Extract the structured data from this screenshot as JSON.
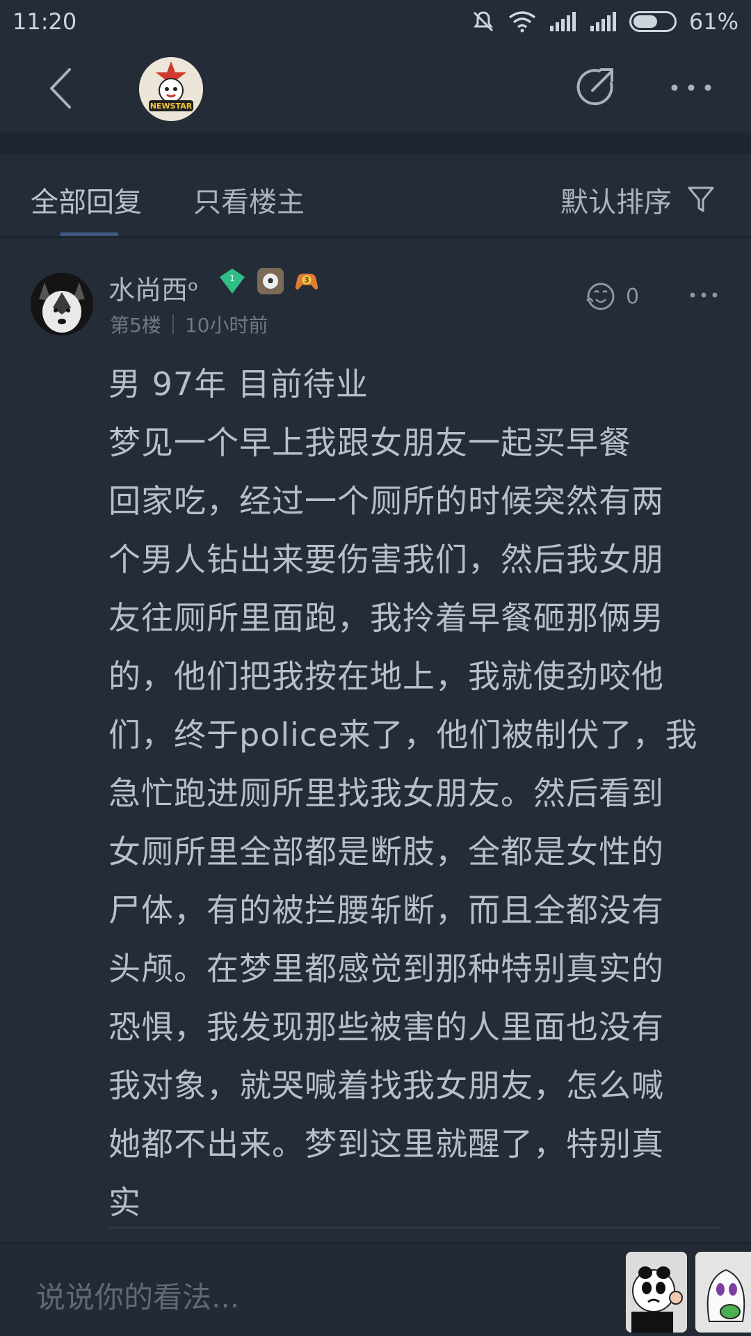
{
  "status_bar": {
    "time": "11:20",
    "battery_percent": "61%",
    "battery_level": 0.61,
    "icons": [
      "mute-icon",
      "wifi-icon",
      "signal-icon",
      "signal-icon",
      "battery-icon"
    ]
  },
  "top_nav": {
    "back_icon": "chevron-left-icon",
    "avatar_text": "NEWSTAR",
    "share_icon": "share-icon",
    "more_icon": "more-horizontal-icon"
  },
  "tabs": {
    "all_replies": "全部回复",
    "only_op": "只看楼主",
    "sort_label": "默认排序",
    "filter_icon": "filter-icon"
  },
  "post": {
    "username": "水尚西ᵒ",
    "badge_level": "1",
    "badge_third": "3",
    "floor": "第5楼",
    "time": "10小时前",
    "like_count": "0",
    "content": "男 97年 目前待业\n梦见一个早上我跟女朋友一起买早餐\n回家吃，经过一个厕所的时候突然有两\n个男人钻出来要伤害我们，然后我女朋\n友往厕所里面跑，我拎着早餐砸那俩男\n的，他们把我按在地上，我就使劲咬他\n们，终于police来了，他们被制伏了，我\n急忙跑进厕所里找我女朋友。然后看到\n女厕所里全部都是断肢，全都是女性的\n尸体，有的被拦腰斩断，而且全都没有\n头颅。在梦里都感觉到那种特别真实的\n恐惧，我发现那些被害的人里面也没有\n我对象，就哭喊着找我女朋友，怎么喊\n她都不出来。梦到这里就醒了，特别真\n实"
  },
  "input_bar": {
    "placeholder": "说说你的看法..."
  },
  "colors": {
    "background": "#242c38",
    "text": "#b6bfca",
    "muted": "#6e7886",
    "accent_underline": "#3e5a82"
  }
}
